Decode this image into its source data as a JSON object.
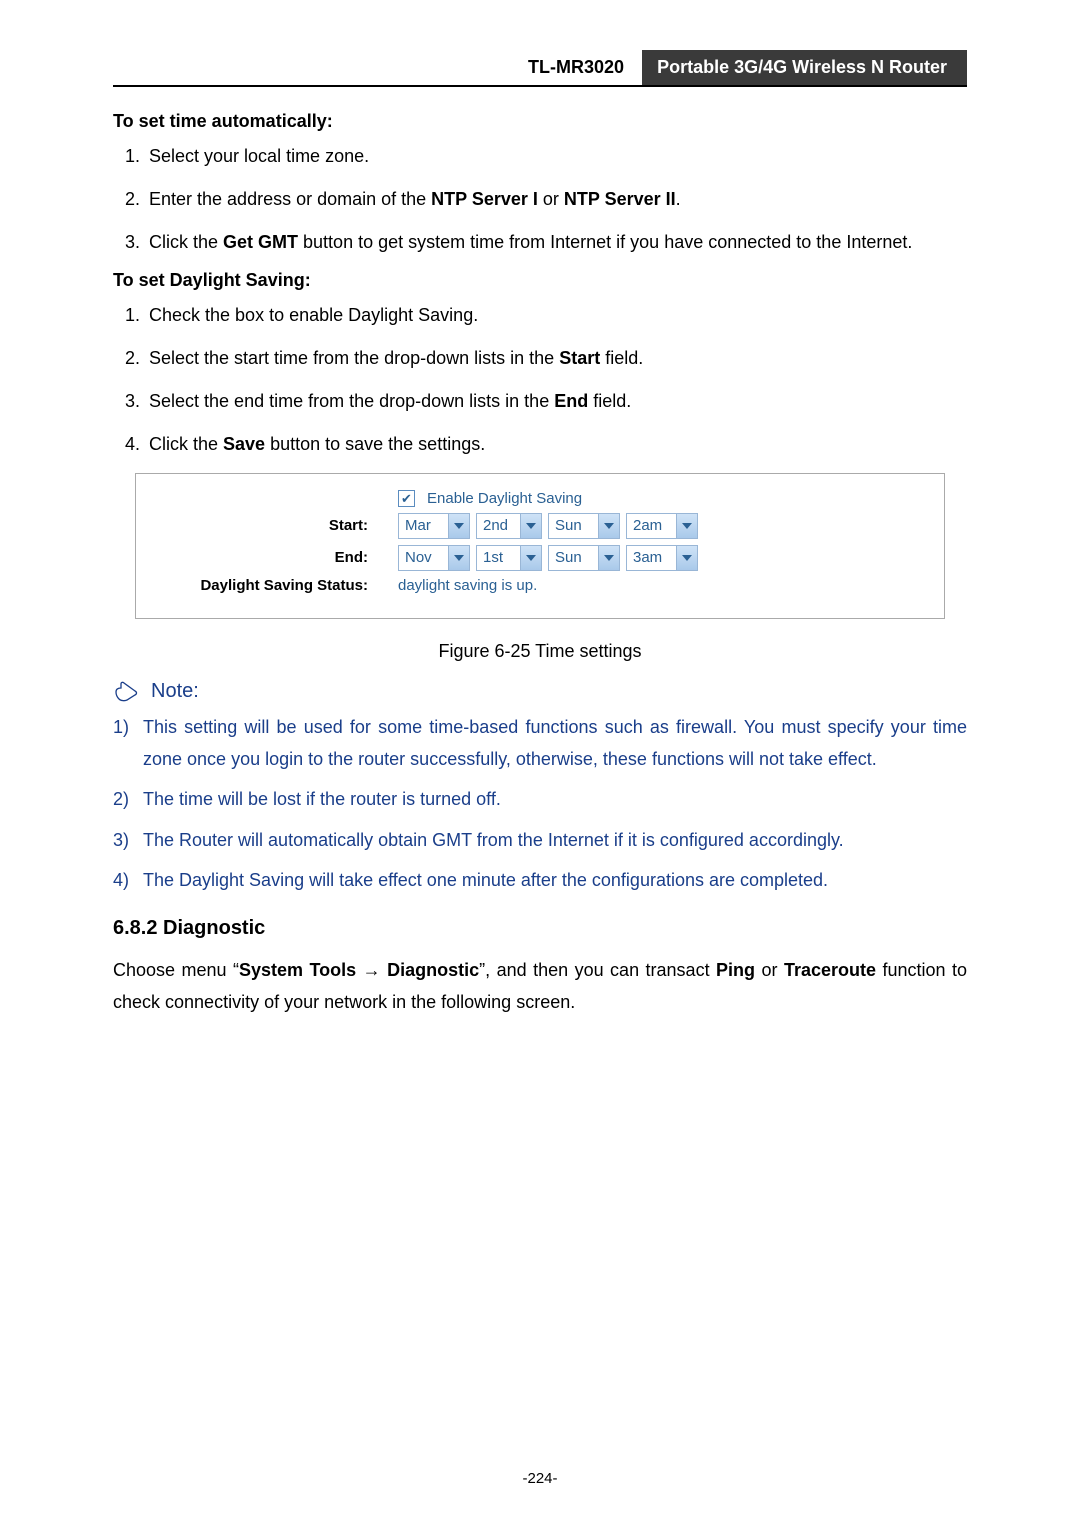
{
  "header": {
    "model": "TL-MR3020",
    "title": "Portable 3G/4G Wireless N Router"
  },
  "sectionA": {
    "title": "To set time automatically:",
    "steps": [
      {
        "text": "Select your local time zone."
      },
      {
        "pre": "Enter the address or domain of the ",
        "b1": "NTP Server I",
        "mid": " or ",
        "b2": "NTP Server II",
        "post": "."
      },
      {
        "pre": "Click the ",
        "b1": "Get GMT",
        "post": " button to get system time from Internet if you have connected to the Internet."
      }
    ]
  },
  "sectionB": {
    "title": "To set Daylight Saving:",
    "steps": [
      {
        "text": "Check the box to enable Daylight Saving."
      },
      {
        "pre": "Select the start time from the drop-down lists in the ",
        "b1": "Start",
        "post": " field."
      },
      {
        "pre": "Select the end time from the drop-down lists in the ",
        "b1": "End",
        "post": " field."
      },
      {
        "pre": "Click the ",
        "b1": "Save",
        "post": " button to save the settings."
      }
    ]
  },
  "figure": {
    "enable_label": "Enable Daylight Saving",
    "start_label": "Start:",
    "end_label": "End:",
    "status_label": "Daylight Saving Status:",
    "status_value": "daylight saving is up.",
    "start": {
      "month": "Mar",
      "week": "2nd",
      "day": "Sun",
      "hour": "2am"
    },
    "end": {
      "month": "Nov",
      "week": "1st",
      "day": "Sun",
      "hour": "3am"
    },
    "caption": "Figure 6-25    Time settings"
  },
  "note": {
    "label": "Note:",
    "items": [
      "This setting will be used for some time-based functions such as firewall. You must specify your time zone once you login to the router successfully, otherwise, these functions will not take effect.",
      "The time will be lost if the router is turned off.",
      "The Router will automatically obtain GMT from the Internet if it is configured accordingly.",
      "The Daylight Saving will take effect one minute after the configurations are completed."
    ],
    "bullets": [
      "1)",
      "2)",
      "3)",
      "4)"
    ]
  },
  "section682": {
    "heading": "6.8.2    Diagnostic",
    "p_pre": "Choose menu “",
    "p_b1": "System Tools",
    "p_arrow": "  →  ",
    "p_b2": "Diagnostic",
    "p_mid": "”, and then you can transact ",
    "p_b3": "Ping",
    "p_or": " or ",
    "p_b4": "Traceroute",
    "p_post": " function to check connectivity of your network in the following screen."
  },
  "pagenum": "-224-"
}
